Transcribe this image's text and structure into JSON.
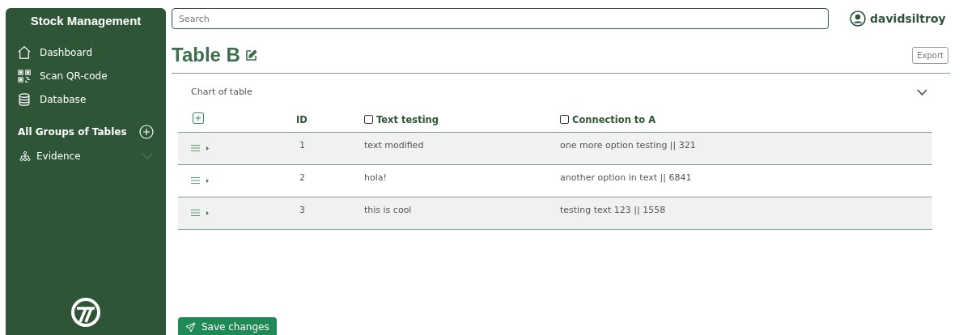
{
  "sidebar": {
    "title": "Stock Management",
    "items": [
      {
        "label": "Dashboard"
      },
      {
        "label": "Scan QR-code"
      },
      {
        "label": "Database"
      }
    ],
    "groups_heading": "All Groups of Tables",
    "groups": [
      {
        "label": "Evidence",
        "expanded": false
      }
    ]
  },
  "search": {
    "placeholder": "Search"
  },
  "user": {
    "name": "davidsiltroy"
  },
  "page": {
    "title": "Table B",
    "export_button": "Export"
  },
  "chart_panel": {
    "label": "Chart of table",
    "expanded": false
  },
  "table": {
    "columns": [
      {
        "label": "ID",
        "kind": "plain"
      },
      {
        "label": "Text testing",
        "kind": "checkbox",
        "checked": false
      },
      {
        "label": "Connection to A",
        "kind": "checkbox",
        "checked": false
      }
    ],
    "rows": [
      {
        "cells": [
          "1",
          "text modified",
          "one more option testing || 321"
        ]
      },
      {
        "cells": [
          "2",
          "hola!",
          "another option in text || 6841"
        ]
      },
      {
        "cells": [
          "3",
          "this is cool",
          "testing text 123 || 1558"
        ]
      }
    ]
  },
  "save_button": "Save changes"
}
